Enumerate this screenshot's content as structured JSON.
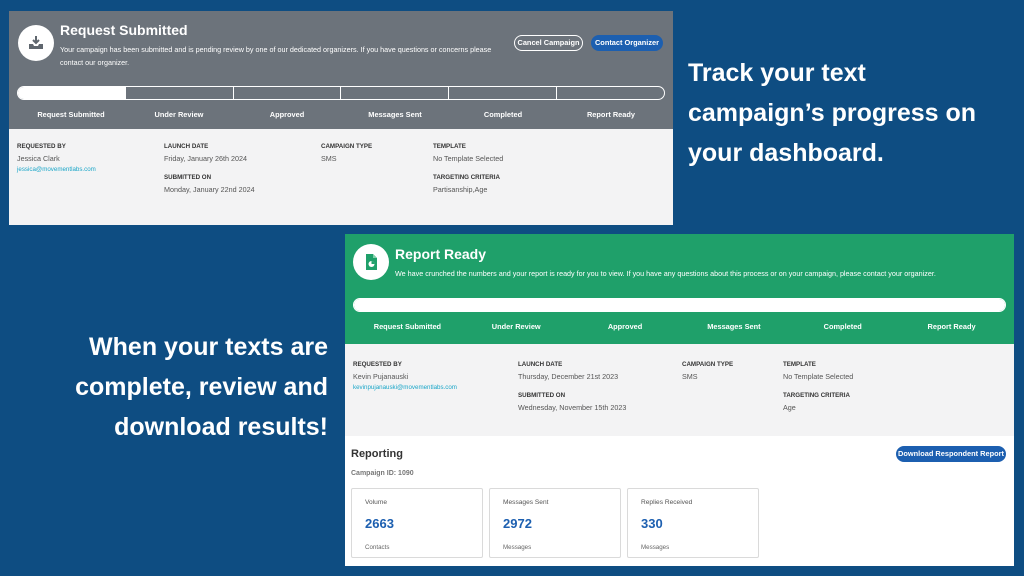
{
  "card_submitted": {
    "title": "Request Submitted",
    "message": "Your campaign has been submitted and is pending review by one of our dedicated organizers. If you have questions or concerns please contact our organizer.",
    "cancel_label": "Cancel Campaign",
    "contact_label": "Contact Organizer",
    "steps": [
      "Request Submitted",
      "Under Review",
      "Approved",
      "Messages Sent",
      "Completed",
      "Report Ready"
    ],
    "progress_completed_steps": 1,
    "requested_by_label": "Requested By",
    "requested_by_name": "Jessica Clark",
    "requested_by_email": "jessica@movementlabs.com",
    "launch_date_label": "Launch Date",
    "launch_date": "Friday, January 26th 2024",
    "submitted_on_label": "Submitted On",
    "submitted_on": "Monday, January 22nd 2024",
    "campaign_type_label": "Campaign Type",
    "campaign_type": "SMS",
    "template_label": "Template",
    "template": "No Template Selected",
    "targeting_label": "Targeting Criteria",
    "targeting": "Partisanship,Age",
    "icon": "inbox-download-icon",
    "banner_color": "#6c737b"
  },
  "card_report": {
    "title": "Report Ready",
    "message": "We have crunched the numbers and your report is ready for you to view. If you have any questions about this process or on your campaign, please contact your organizer.",
    "steps": [
      "Request Submitted",
      "Under Review",
      "Approved",
      "Messages Sent",
      "Completed",
      "Report Ready"
    ],
    "progress_completed_steps": 6,
    "requested_by_label": "Requested By",
    "requested_by_name": "Kevin Pujanauski",
    "requested_by_email": "kevinpujanauski@movementlabs.com",
    "launch_date_label": "Launch Date",
    "launch_date": "Thursday, December 21st 2023",
    "submitted_on_label": "Submitted On",
    "submitted_on": "Wednesday, November 15th 2023",
    "campaign_type_label": "Campaign Type",
    "campaign_type": "SMS",
    "template_label": "Template",
    "template": "No Template Selected",
    "targeting_label": "Targeting Criteria",
    "targeting": "Age",
    "reporting_title": "Reporting",
    "campaign_id": "Campaign ID: 1090",
    "download_label": "Download Respondent Report",
    "stats": [
      {
        "label": "Volume",
        "value": "2663",
        "unit": "Contacts"
      },
      {
        "label": "Messages Sent",
        "value": "2972",
        "unit": "Messages"
      },
      {
        "label": "Replies Received",
        "value": "330",
        "unit": "Messages"
      }
    ],
    "icon": "report-document-icon",
    "banner_color": "#1fa06a"
  },
  "headline_right": "Track your text campaign’s progress on your dashboard.",
  "headline_left": "When your texts are complete, review and download results!",
  "colors": {
    "background": "#0e4d82",
    "accent_blue": "#1c5fb0",
    "link": "#1aa6c8"
  }
}
